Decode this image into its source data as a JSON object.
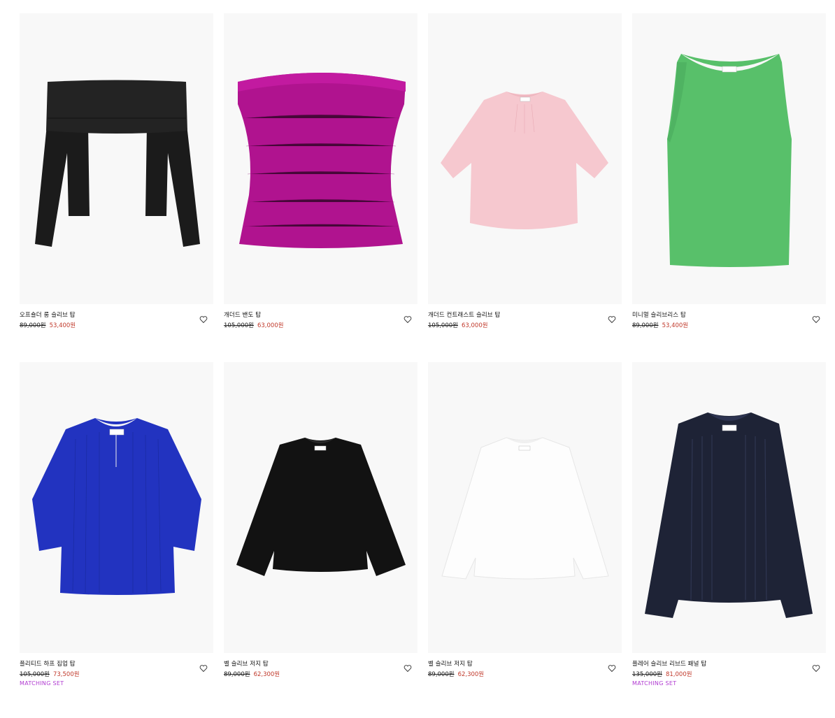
{
  "products": [
    {
      "name": "오프숄더 롱 슬리브 탑",
      "old_price": "89,000원",
      "new_price": "53,400원",
      "badge": "",
      "color": "#1b1b1b",
      "icon": "heart-icon"
    },
    {
      "name": "개더드 밴도 탑",
      "old_price": "105,000원",
      "new_price": "63,000원",
      "badge": "",
      "color": "#b0138f",
      "icon": "heart-icon"
    },
    {
      "name": "개더드 컨트래스트 슬리브 탑",
      "old_price": "105,000원",
      "new_price": "63,000원",
      "badge": "",
      "color": "#f6c8cf",
      "icon": "heart-icon"
    },
    {
      "name": "미니멀 슬리브리스 탑",
      "old_price": "89,000원",
      "new_price": "53,400원",
      "badge": "",
      "color": "#58c06a",
      "icon": "heart-icon"
    },
    {
      "name": "플리티드 하프 집업 탑",
      "old_price": "105,000원",
      "new_price": "73,500원",
      "badge": "MATCHING SET",
      "color": "#2233c0",
      "icon": "heart-icon"
    },
    {
      "name": "벨 슬리브 저지 탑",
      "old_price": "89,000원",
      "new_price": "62,300원",
      "badge": "",
      "color": "#121212",
      "icon": "heart-icon"
    },
    {
      "name": "벨 슬리브 저지 탑",
      "old_price": "89,000원",
      "new_price": "62,300원",
      "badge": "",
      "color": "#fafafa",
      "icon": "heart-icon"
    },
    {
      "name": "플레어 슬리브 리브드 패널 탑",
      "old_price": "135,000원",
      "new_price": "81,000원",
      "badge": "MATCHING SET",
      "color": "#1e2336",
      "icon": "heart-icon"
    }
  ],
  "colors": {
    "sale_price": "#c0392b",
    "badge": "#b03ad1",
    "image_bg": "#f8f8f8"
  }
}
